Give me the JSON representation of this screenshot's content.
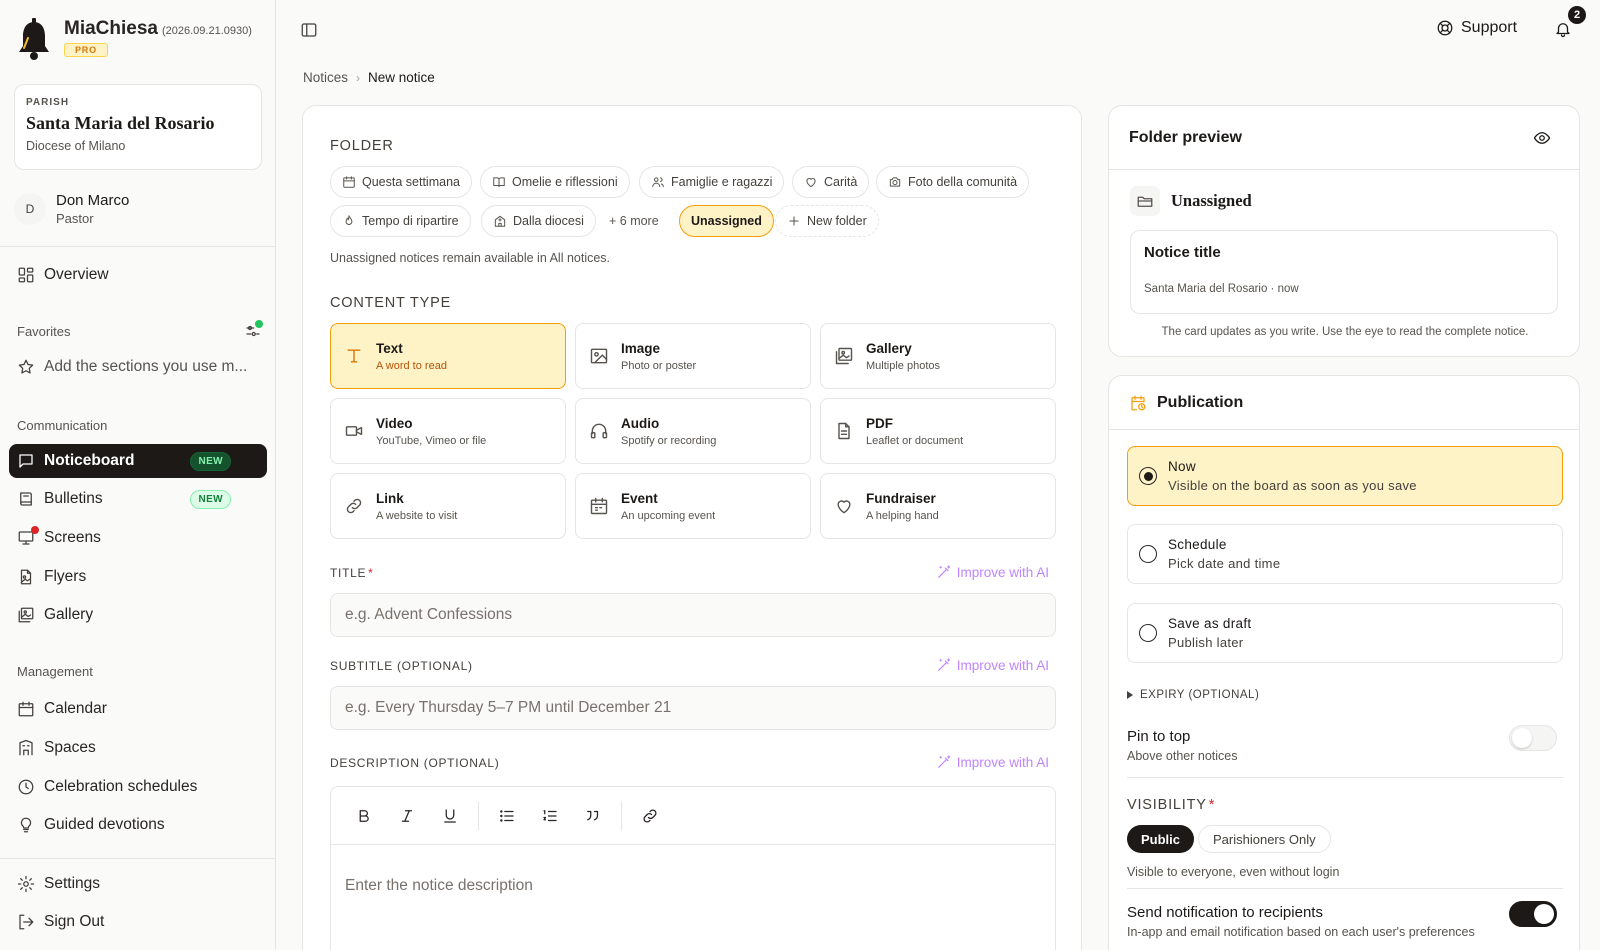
{
  "app": {
    "name": "MiaChiesa",
    "version": "(2026.09.21.0930)",
    "plan": "PRO"
  },
  "parish": {
    "label": "PARISH",
    "name": "Santa Maria del Rosario",
    "diocese": "Diocese of Milano"
  },
  "user": {
    "initial": "D",
    "name": "Don Marco",
    "role": "Pastor"
  },
  "nav": {
    "overview": "Overview",
    "favorites_label": "Favorites",
    "favorites_hint": "Add the sections you use m...",
    "communication_label": "Communication",
    "noticeboard": "Noticeboard",
    "bulletins": "Bulletins",
    "screens": "Screens",
    "flyers": "Flyers",
    "gallery": "Gallery",
    "new_badge": "NEW",
    "management_label": "Management",
    "calendar": "Calendar",
    "spaces": "Spaces",
    "celebrations": "Celebration schedules",
    "devotions": "Guided devotions",
    "settings": "Settings",
    "signout": "Sign Out"
  },
  "topbar": {
    "support": "Support",
    "notification_count": "2"
  },
  "breadcrumb": {
    "parent": "Notices",
    "current": "New notice"
  },
  "form": {
    "folder_label": "FOLDER",
    "folders": [
      "Questa settimana",
      "Omelie e riflessioni",
      "Famiglie e ragazzi",
      "Carità",
      "Foto della comunità",
      "Tempo di ripartire",
      "Dalla diocesi"
    ],
    "more": "+ 6 more",
    "unassigned": "Unassigned",
    "new_folder": "New folder",
    "folder_hint": "Unassigned notices remain available in All notices.",
    "content_type_label": "CONTENT TYPE",
    "content_types": [
      {
        "title": "Text",
        "desc": "A word to read"
      },
      {
        "title": "Image",
        "desc": "Photo or poster"
      },
      {
        "title": "Gallery",
        "desc": "Multiple photos"
      },
      {
        "title": "Video",
        "desc": "YouTube, Vimeo or file"
      },
      {
        "title": "Audio",
        "desc": "Spotify or recording"
      },
      {
        "title": "PDF",
        "desc": "Leaflet or document"
      },
      {
        "title": "Link",
        "desc": "A website to visit"
      },
      {
        "title": "Event",
        "desc": "An upcoming event"
      },
      {
        "title": "Fundraiser",
        "desc": "A helping hand"
      }
    ],
    "title_label": "TITLE",
    "title_placeholder": "e.g. Advent Confessions",
    "subtitle_label": "SUBTITLE (OPTIONAL)",
    "subtitle_placeholder": "e.g. Every Thursday 5–7 PM until December 21",
    "description_label": "DESCRIPTION (OPTIONAL)",
    "description_placeholder": "Enter the notice description",
    "improve_ai": "Improve with AI",
    "required_mark": "*"
  },
  "preview": {
    "title": "Folder preview",
    "folder": "Unassigned",
    "notice_title": "Notice title",
    "notice_meta": "Santa Maria del Rosario · now",
    "hint": "The card updates as you write. Use the eye to read the complete notice."
  },
  "publication": {
    "title": "Publication",
    "options": [
      {
        "title": "Now",
        "desc": "Visible on the board as soon as you save"
      },
      {
        "title": "Schedule",
        "desc": "Pick date and time"
      },
      {
        "title": "Save as draft",
        "desc": "Publish later"
      }
    ],
    "expiry": "EXPIRY (OPTIONAL)",
    "pin_title": "Pin to top",
    "pin_desc": "Above other notices",
    "visibility_label": "VISIBILITY",
    "vis_public": "Public",
    "vis_parishioners": "Parishioners Only",
    "vis_hint": "Visible to everyone, even without login",
    "notify_title": "Send notification to recipients",
    "notify_desc": "In-app and email notification based on each user's preferences"
  },
  "colors": {
    "accent": "#f59e0b",
    "accent_bg": "#fef3c7",
    "dark": "#1c1917",
    "ai": "#c084fc"
  }
}
